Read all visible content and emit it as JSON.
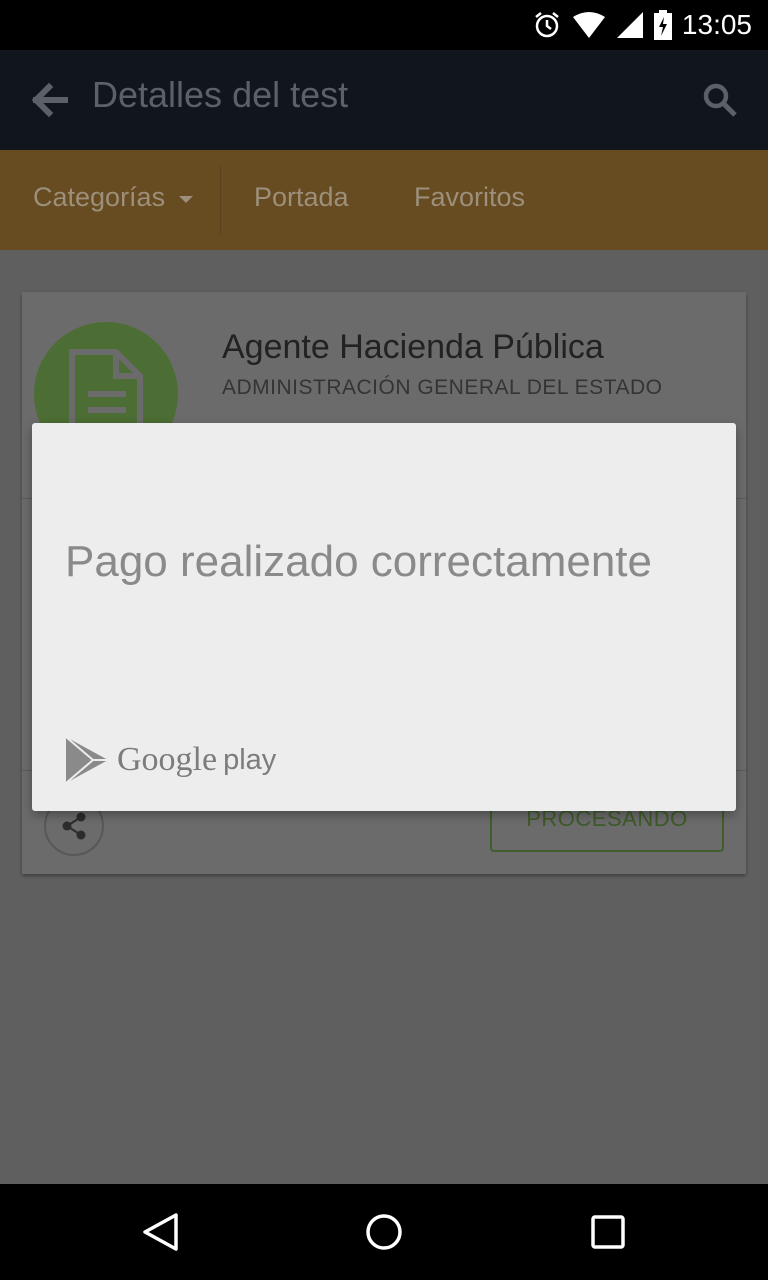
{
  "status_bar": {
    "time": "13:05",
    "icons": [
      "alarm-icon",
      "wifi-icon",
      "signal-icon",
      "battery-charging-icon"
    ]
  },
  "app_bar": {
    "title": "Detalles del test",
    "back_icon": "arrow-left-icon",
    "search_icon": "search-icon"
  },
  "tabs": {
    "categories": "Categorías",
    "home": "Portada",
    "favorites": "Favoritos"
  },
  "card": {
    "title": "Agente Hacienda Pública",
    "subtitle": "ADMINISTRACIÓN GENERAL DEL ESTADO",
    "status_button": "PROCESANDO"
  },
  "dialog": {
    "message": "Pago realizado correctamente",
    "brand_google": "Google",
    "brand_play": "play"
  },
  "nav_bar": {
    "icons": [
      "back-triangle-icon",
      "home-circle-icon",
      "recents-square-icon"
    ]
  },
  "colors": {
    "app_bar": "#11161c",
    "tab_bar": "#674b21",
    "scrim": "#5f5f5f",
    "dialog_bg": "#ededed"
  }
}
